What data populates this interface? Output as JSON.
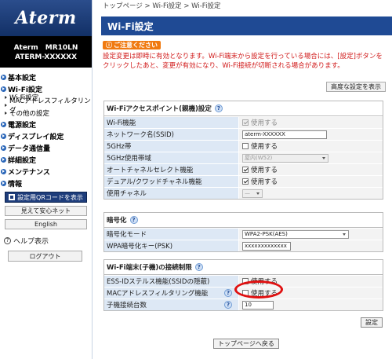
{
  "sidebar": {
    "logo": "Aterm",
    "model_line1": "Aterm　MR10LN",
    "model_line2": "ATERM-XXXXXX",
    "nav": [
      {
        "label": "基本設定"
      },
      {
        "label": "Wi-Fi設定",
        "subs": [
          "Wi-Fi設定",
          "MACアドレスフィルタリング",
          "その他の設定"
        ]
      },
      {
        "label": "電源設定"
      },
      {
        "label": "ディスプレイ設定"
      },
      {
        "label": "データ通信量"
      },
      {
        "label": "詳細設定"
      },
      {
        "label": "メンテナンス"
      },
      {
        "label": "情報"
      }
    ],
    "qr_button": "設定用QRコードを表示",
    "mieru_button": "見えて安心ネット",
    "english_button": "English",
    "help_label": "ヘルプ表示",
    "logout_button": "ログアウト"
  },
  "main": {
    "breadcrumb": "トップページ > Wi-Fi設定 > Wi-Fi設定",
    "title": "Wi-Fi設定",
    "notice_badge": "ご注意ください",
    "notice_text": "設定変更は即時に有効となります。Wi-Fi端末から設定を行っている場合には、[設定]ボタンをクリックしたあと、変更が有効になり、Wi-Fi接続が切断される場合があります。",
    "advanced_button": "高度な設定を表示",
    "sections": {
      "ap": {
        "title": "Wi-Fiアクセスポイント(親機)設定",
        "rows": {
          "wifi_func": {
            "label": "Wi-Fi機能",
            "value": "使用する"
          },
          "ssid": {
            "label": "ネットワーク名(SSID)",
            "value": "aterm-XXXXXX"
          },
          "band5": {
            "label": "5GHz帯",
            "value": "使用する"
          },
          "band5_use": {
            "label": "5GHz使用帯域",
            "value": "屋内(W52)"
          },
          "auto_ch": {
            "label": "オートチャネルセレクト機能",
            "value": "使用する"
          },
          "dual": {
            "label": "デュアル/クワッドチャネル機能",
            "value": "使用する"
          },
          "channel": {
            "label": "使用チャネル",
            "value": "—"
          }
        }
      },
      "enc": {
        "title": "暗号化",
        "rows": {
          "mode": {
            "label": "暗号化モード",
            "value": "WPA2-PSK(AES)"
          },
          "key": {
            "label": "WPA暗号化キー(PSK)",
            "value": "xxxxxxxxxxxxx"
          }
        }
      },
      "limit": {
        "title": "Wi-Fi端末(子機)の接続制限",
        "rows": {
          "stealth": {
            "label": "ESS-IDステルス機能(SSIDの隠蔽)",
            "value": "使用する"
          },
          "mac": {
            "label": "MACアドレスフィルタリング機能",
            "value": "使用する"
          },
          "count": {
            "label": "子機接続台数",
            "value": "10"
          }
        }
      }
    },
    "save_button": "設定",
    "toppage_button": "トップページへ戻る"
  },
  "colors": {
    "brand": "#1f4a94",
    "notice": "#f07a10",
    "warning_text": "#d01818",
    "highlight": "#e01010"
  }
}
